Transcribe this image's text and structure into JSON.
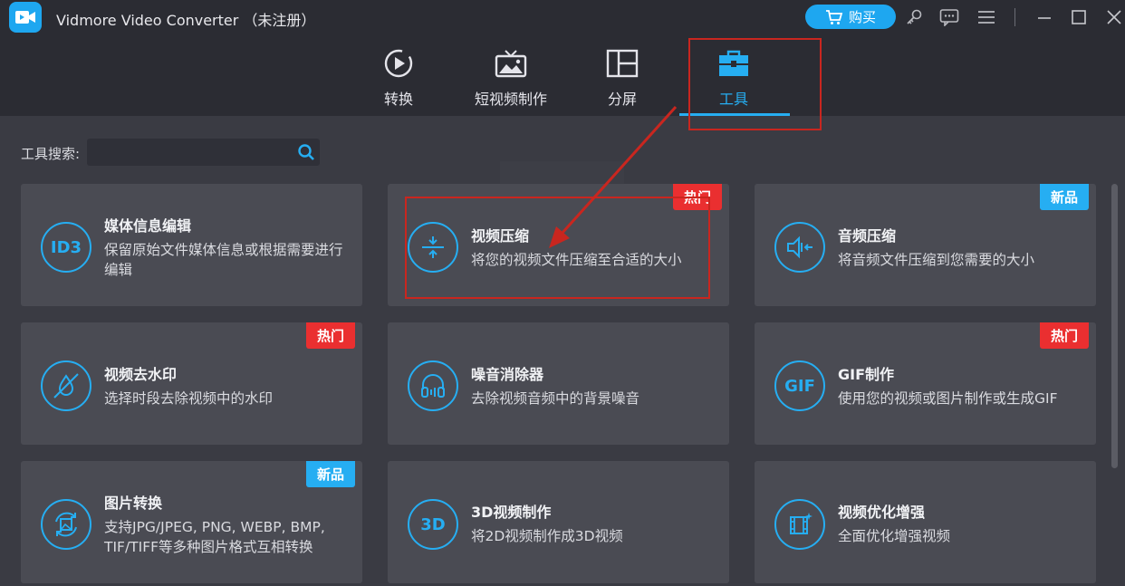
{
  "app": {
    "title": "Vidmore Video Converter （未注册）",
    "buy_label": "购买"
  },
  "titlebar_icons": [
    "key-icon",
    "feedback-icon",
    "menu-icon",
    "minimize-icon",
    "maximize-icon",
    "close-icon"
  ],
  "nav": {
    "tabs": [
      {
        "label": "转换",
        "icon": "convert-icon",
        "active": false
      },
      {
        "label": "短视频制作",
        "icon": "mv-icon",
        "active": false
      },
      {
        "label": "分屏",
        "icon": "collage-icon",
        "active": false
      },
      {
        "label": "工具",
        "icon": "toolbox-icon",
        "active": true
      }
    ]
  },
  "search": {
    "label": "工具搜索:",
    "value": "",
    "placeholder": ""
  },
  "tools": [
    {
      "title": "媒体信息编辑",
      "desc": "保留原始文件媒体信息或根据需要进行编辑",
      "icon_text": "ID3",
      "badge": ""
    },
    {
      "title": "视频压缩",
      "desc": "将您的视频文件压缩至合适的大小",
      "icon_text": "",
      "badge": "热门"
    },
    {
      "title": "音频压缩",
      "desc": "将音频文件压缩到您需要的大小",
      "icon_text": "",
      "badge": "新品"
    },
    {
      "title": "视频去水印",
      "desc": "选择时段去除视频中的水印",
      "icon_text": "",
      "badge": "热门"
    },
    {
      "title": "噪音消除器",
      "desc": "去除视频音频中的背景噪音",
      "icon_text": "",
      "badge": ""
    },
    {
      "title": "GIF制作",
      "desc": "使用您的视频或图片制作或生成GIF",
      "icon_text": "GIF",
      "badge": "热门"
    },
    {
      "title": "图片转换",
      "desc": "支持JPG/JPEG, PNG, WEBP, BMP, TIF/TIFF等多种图片格式互相转换",
      "icon_text": "",
      "badge": "新品"
    },
    {
      "title": "3D视频制作",
      "desc": "将2D视频制作成3D视频",
      "icon_text": "3D",
      "badge": ""
    },
    {
      "title": "视频优化增强",
      "desc": "全面优化增强视频",
      "icon_text": "",
      "badge": ""
    }
  ],
  "colors": {
    "accent": "#26aef2",
    "hot": "#ea2f30",
    "annotation": "#c9261f"
  }
}
